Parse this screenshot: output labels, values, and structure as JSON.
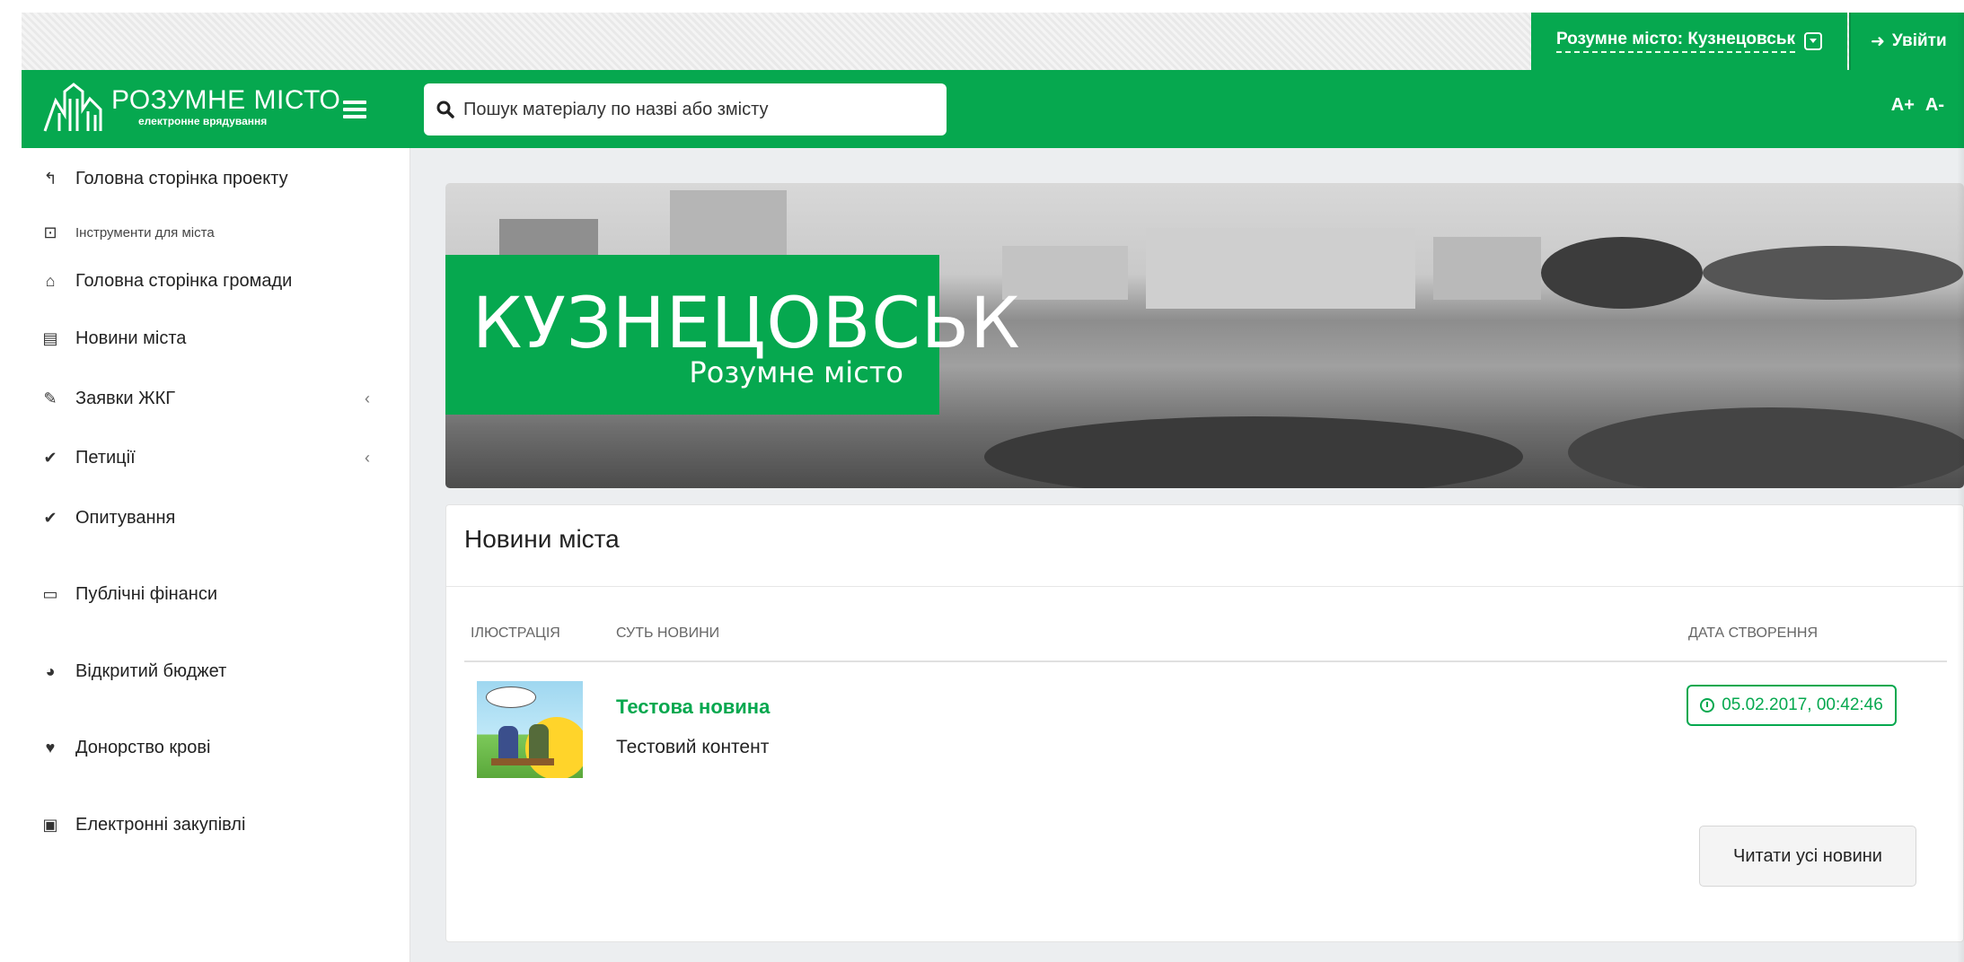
{
  "topbar": {
    "city_select_label": "Розумне місто: Кузнецовськ",
    "login_label": "Увійти"
  },
  "header": {
    "logo_title": "РОЗУМНЕ МІСТО",
    "logo_subtitle": "електронне врядування",
    "search_placeholder": "Пошук матеріалу по назві або змісту",
    "font_increase": "A+",
    "font_decrease": "A-"
  },
  "sidebar": {
    "items": [
      {
        "label": "Головна сторінка проекту",
        "icon": "reply-icon"
      },
      {
        "label": "Інструменти для міста",
        "icon": "caret-square-icon"
      },
      {
        "label": "Головна сторінка громади",
        "icon": "home-icon"
      },
      {
        "label": "Новини міста",
        "icon": "newspaper-icon"
      },
      {
        "label": "Заявки ЖКГ",
        "icon": "wrench-icon",
        "chevron": "‹"
      },
      {
        "label": "Петиції",
        "icon": "check-icon",
        "chevron": "‹"
      },
      {
        "label": "Опитування",
        "icon": "check-icon"
      },
      {
        "label": "Публічні фінанси",
        "icon": "credit-card-icon"
      },
      {
        "label": "Відкритий бюджет",
        "icon": "pie-chart-icon"
      },
      {
        "label": "Донорство крові",
        "icon": "heartbeat-icon"
      },
      {
        "label": "Електронні закупівлі",
        "icon": "money-icon"
      }
    ]
  },
  "banner": {
    "city": "КУЗНЕЦОВСЬК",
    "tagline": "Розумне місто"
  },
  "news": {
    "title": "Новини міста",
    "columns": [
      "ІЛЮСТРАЦІЯ",
      "СУТЬ НОВИНИ",
      "ДАТА СТВОРЕННЯ"
    ],
    "rows": [
      {
        "title": "Тестова новина",
        "body": "Тестовий контент",
        "date": "05.02.2017, 00:42:46"
      }
    ],
    "read_all_label": "Читати усі новини"
  },
  "colors": {
    "brand_green": "#06a84f"
  }
}
